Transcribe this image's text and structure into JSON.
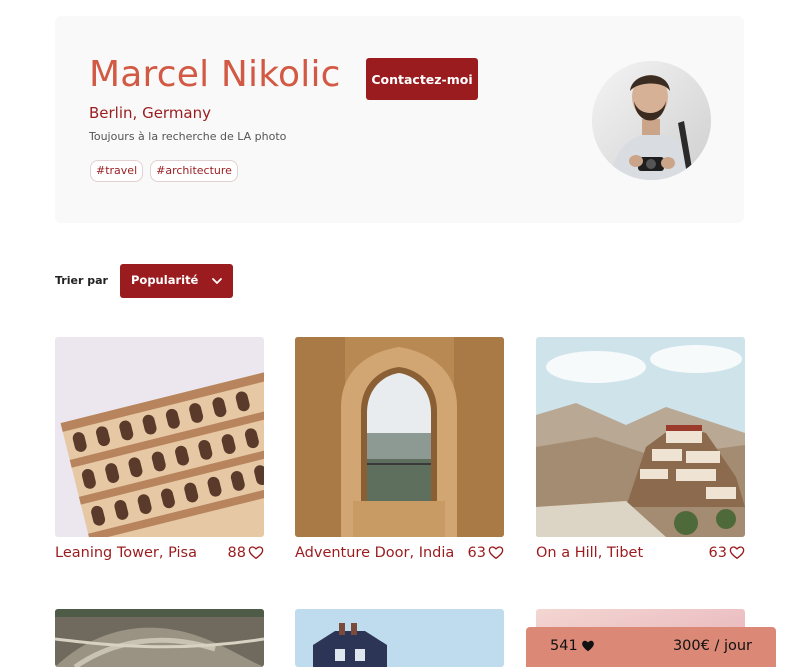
{
  "profile": {
    "name": "Marcel Nikolic",
    "location": "Berlin, Germany",
    "tagline": "Toujours à la recherche de LA photo",
    "contact_label": "Contactez-moi",
    "tags": [
      "#travel",
      "#architecture"
    ]
  },
  "sort": {
    "label": "Trier par",
    "selected": "Popularité",
    "icon": "chevron-down-icon"
  },
  "media": [
    {
      "title": "Leaning Tower, Pisa",
      "likes": "88",
      "icon": "heart-outline-icon"
    },
    {
      "title": "Adventure Door, India",
      "likes": "63",
      "icon": "heart-outline-icon"
    },
    {
      "title": "On a Hill, Tibet",
      "likes": "63",
      "icon": "heart-outline-icon"
    }
  ],
  "footer": {
    "total_likes": "541",
    "price": "300€ / jour",
    "icon": "heart-filled-icon"
  },
  "colors": {
    "accent": "#9a1c1f",
    "name": "#d25a44",
    "price_bar": "#db8876",
    "header_bg": "#f9f9f9"
  }
}
